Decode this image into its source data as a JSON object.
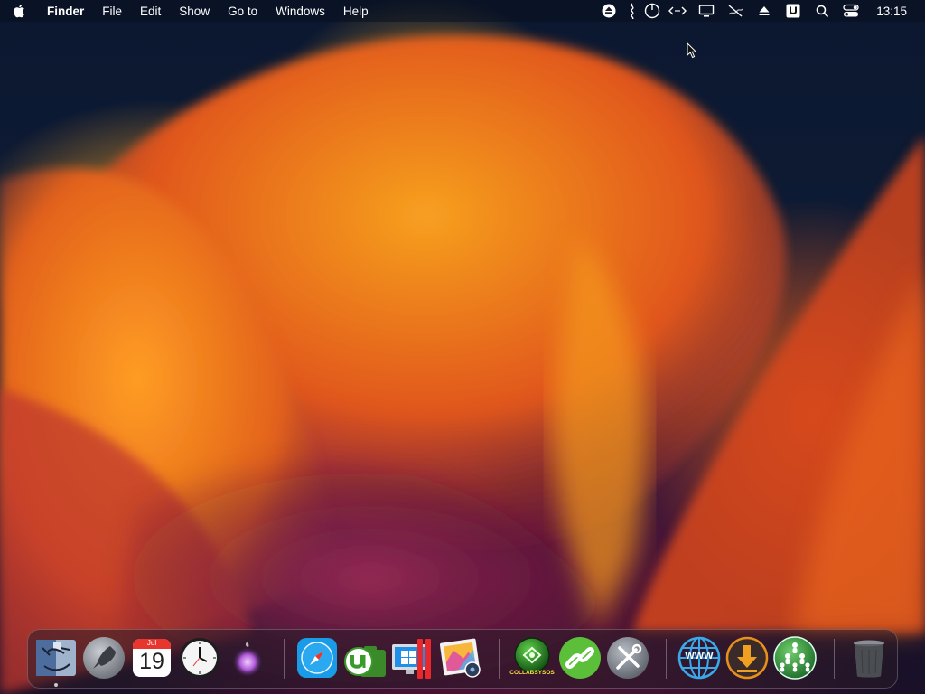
{
  "menubar": {
    "app_name": "Finder",
    "items": [
      "File",
      "Edit",
      "Show",
      "Go to",
      "Windows",
      "Help"
    ],
    "clock": "13:15",
    "status_icons": [
      "eject-icon",
      "tuner-icon",
      "power-icon",
      "code-arrows-icon",
      "display-icon",
      "crossed-out-icon",
      "eject-icon",
      "u-badge-icon",
      "search-icon",
      "control-center-icon"
    ]
  },
  "dock": {
    "apps": [
      {
        "name": "finder-app-icon"
      },
      {
        "name": "launchpad-rocket-icon"
      },
      {
        "name": "calendar-icon",
        "month": "Jul",
        "day": "19"
      },
      {
        "name": "clock-app-icon"
      },
      {
        "name": "siri-icon"
      },
      {
        "name": "safari-icon"
      },
      {
        "name": "utorrent-icon"
      },
      {
        "name": "parallels-windows-icon"
      },
      {
        "name": "photo-viewer-icon"
      },
      {
        "name": "collabsysos-icon",
        "label": "COLLABSYSOS"
      },
      {
        "name": "link-icon"
      },
      {
        "name": "tools-icon"
      },
      {
        "name": "www-globe-icon",
        "label": "WWW"
      },
      {
        "name": "download-icon"
      },
      {
        "name": "network-people-icon"
      },
      {
        "name": "trash-icon"
      }
    ]
  },
  "colors": {
    "menubar_text": "#ffffff",
    "safari_blue": "#1a9be8",
    "calendar_red": "#e8352e",
    "link_green": "#5bbf3a",
    "download_orange": "#e8901c"
  }
}
